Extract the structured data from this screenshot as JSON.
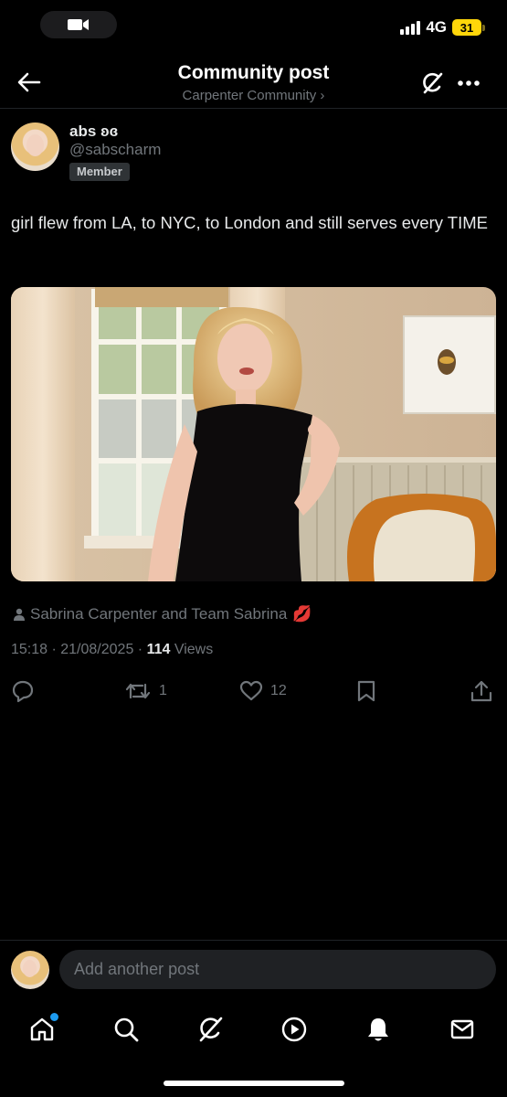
{
  "status_bar": {
    "network": "4G",
    "battery_level": "31",
    "battery_color": "#ffd60a"
  },
  "header": {
    "title": "Community post",
    "subtitle": "Carpenter Community ›"
  },
  "post": {
    "author_name": "abs ʚɞ",
    "author_handle": "@sabscharm",
    "badge": "Member",
    "text": "girl flew from LA, to NYC, to London and still serves every TIME",
    "community_line": "Sabrina Carpenter and Team Sabrina",
    "community_emoji": "💋",
    "timestamp": "15:18 · 21/08/2025 · ",
    "views_count": "114",
    "views_label": " Views",
    "actions": {
      "reply_count": "",
      "repost_count": "1",
      "like_count": "12"
    }
  },
  "composer": {
    "placeholder": "Add another post"
  },
  "colors": {
    "accent": "#1d9bf0",
    "muted_text": "#71767b",
    "primary_text": "#e7e9ea"
  },
  "icons": {
    "back": "arrow-left-icon",
    "grok": "grok-slash-icon",
    "more": "more-horizontal-icon",
    "reply": "comment-bubble-icon",
    "repost": "repost-arrows-icon",
    "like": "heart-icon",
    "bookmark": "bookmark-icon",
    "share": "share-upload-icon",
    "home": "home-icon",
    "search": "search-icon",
    "video": "play-circle-icon",
    "notifications": "bell-icon",
    "messages": "envelope-icon"
  }
}
